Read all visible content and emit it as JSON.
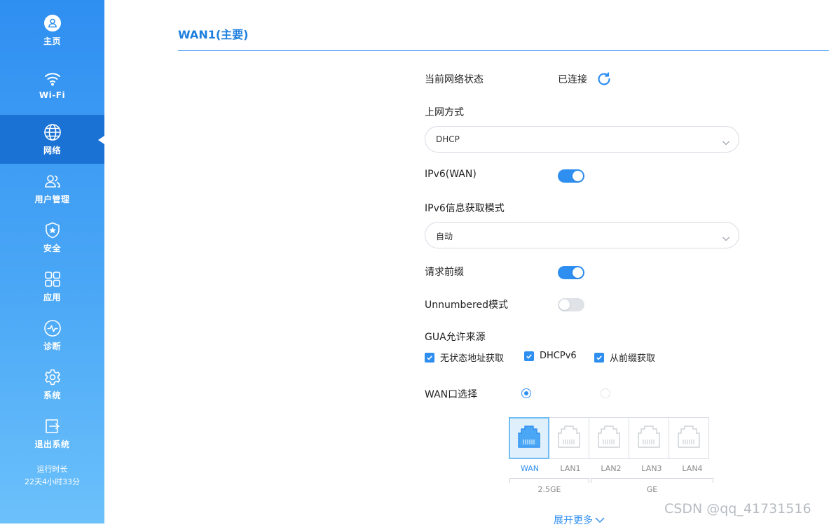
{
  "sidebar": {
    "items": [
      {
        "label": "主页",
        "icon": "home-user-icon"
      },
      {
        "label": "Wi-Fi",
        "icon": "wifi-icon"
      },
      {
        "label": "网络",
        "icon": "globe-icon",
        "active": true
      },
      {
        "label": "用户管理",
        "icon": "users-icon"
      },
      {
        "label": "安全",
        "icon": "shield-star-icon"
      },
      {
        "label": "应用",
        "icon": "apps-grid-icon"
      },
      {
        "label": "诊断",
        "icon": "pulse-icon"
      },
      {
        "label": "系统",
        "icon": "gear-icon"
      },
      {
        "label": "退出系统",
        "icon": "logout-icon"
      }
    ],
    "uptime_label": "运行时长",
    "uptime_value": "22天4小时33分"
  },
  "page": {
    "title": "WAN1(主要)"
  },
  "form": {
    "status_label": "当前网络状态",
    "status_value": "已连接",
    "access_mode_label": "上网方式",
    "access_mode_value": "DHCP",
    "ipv6_label": "IPv6(WAN)",
    "ipv6_on": true,
    "ipv6_mode_label": "IPv6信息获取模式",
    "ipv6_mode_value": "自动",
    "prefix_label": "请求前缀",
    "prefix_on": true,
    "unnumbered_label": "Unnumbered模式",
    "unnumbered_on": false,
    "gua_label": "GUA允许来源",
    "gua_options": [
      {
        "label": "无状态地址获取",
        "checked": true
      },
      {
        "label": "DHCPv6",
        "checked": true
      },
      {
        "label": "从前缀获取",
        "checked": true
      }
    ],
    "wan_port_label": "WAN口选择",
    "ports": [
      {
        "label": "WAN",
        "selected": true
      },
      {
        "label": "LAN1",
        "selected": false
      },
      {
        "label": "LAN2",
        "selected": false
      },
      {
        "label": "LAN3",
        "selected": false
      },
      {
        "label": "LAN4",
        "selected": false
      }
    ],
    "speed_groups": [
      "2.5GE",
      "GE"
    ],
    "expand_label": "展开更多"
  },
  "watermark": "CSDN @qq_41731516",
  "colors": {
    "accent": "#2f8ff1",
    "sidebar_active": "#1a73d4"
  }
}
